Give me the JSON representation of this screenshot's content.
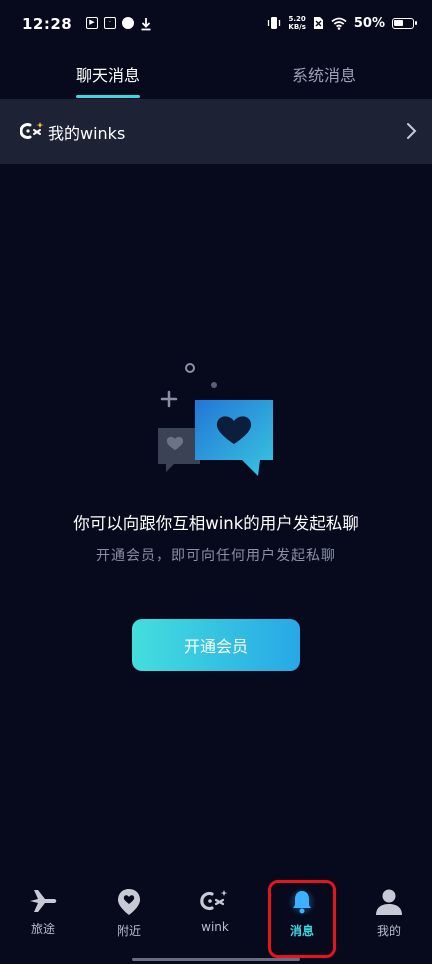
{
  "status_bar": {
    "time": "12:28",
    "net_speed_top": "5.20",
    "net_speed_bottom": "KB/s",
    "battery": "50%"
  },
  "tabs": [
    {
      "label": "聊天消息",
      "active": true
    },
    {
      "label": "系统消息",
      "active": false
    }
  ],
  "winks_banner": {
    "label": "我的winks"
  },
  "empty_state": {
    "title": "你可以向跟你互相wink的用户发起私聊",
    "subtitle": "开通会员，即可向任何用户发起私聊",
    "button_label": "开通会员"
  },
  "bottom_nav": [
    {
      "label": "旅途",
      "icon": "airplane-icon"
    },
    {
      "label": "附近",
      "icon": "location-pin-icon"
    },
    {
      "label": "wink",
      "icon": "wink-icon"
    },
    {
      "label": "消息",
      "icon": "bell-icon",
      "active": true
    },
    {
      "label": "我的",
      "icon": "user-icon"
    }
  ],
  "colors": {
    "background": "#070a1c",
    "banner": "#1d2335",
    "accent": "#3ed7df",
    "button_start": "#44dedd",
    "button_end": "#27a8e6"
  }
}
